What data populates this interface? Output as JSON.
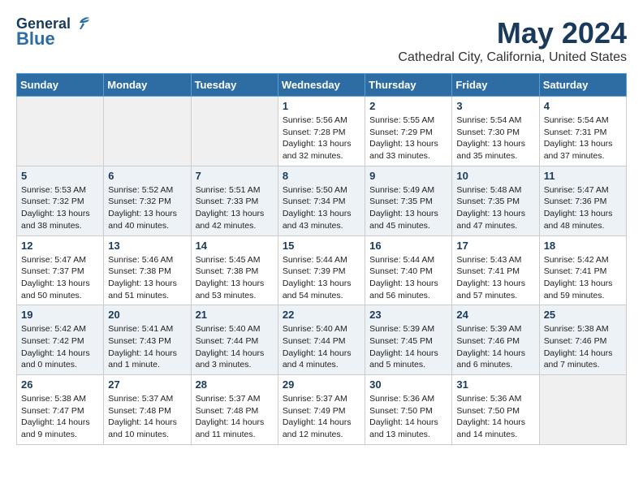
{
  "logo": {
    "line1": "General",
    "line2": "Blue"
  },
  "title": "May 2024",
  "location": "Cathedral City, California, United States",
  "days_of_week": [
    "Sunday",
    "Monday",
    "Tuesday",
    "Wednesday",
    "Thursday",
    "Friday",
    "Saturday"
  ],
  "weeks": [
    [
      {
        "day": "",
        "info": ""
      },
      {
        "day": "",
        "info": ""
      },
      {
        "day": "",
        "info": ""
      },
      {
        "day": "1",
        "info": "Sunrise: 5:56 AM\nSunset: 7:28 PM\nDaylight: 13 hours\nand 32 minutes."
      },
      {
        "day": "2",
        "info": "Sunrise: 5:55 AM\nSunset: 7:29 PM\nDaylight: 13 hours\nand 33 minutes."
      },
      {
        "day": "3",
        "info": "Sunrise: 5:54 AM\nSunset: 7:30 PM\nDaylight: 13 hours\nand 35 minutes."
      },
      {
        "day": "4",
        "info": "Sunrise: 5:54 AM\nSunset: 7:31 PM\nDaylight: 13 hours\nand 37 minutes."
      }
    ],
    [
      {
        "day": "5",
        "info": "Sunrise: 5:53 AM\nSunset: 7:32 PM\nDaylight: 13 hours\nand 38 minutes."
      },
      {
        "day": "6",
        "info": "Sunrise: 5:52 AM\nSunset: 7:32 PM\nDaylight: 13 hours\nand 40 minutes."
      },
      {
        "day": "7",
        "info": "Sunrise: 5:51 AM\nSunset: 7:33 PM\nDaylight: 13 hours\nand 42 minutes."
      },
      {
        "day": "8",
        "info": "Sunrise: 5:50 AM\nSunset: 7:34 PM\nDaylight: 13 hours\nand 43 minutes."
      },
      {
        "day": "9",
        "info": "Sunrise: 5:49 AM\nSunset: 7:35 PM\nDaylight: 13 hours\nand 45 minutes."
      },
      {
        "day": "10",
        "info": "Sunrise: 5:48 AM\nSunset: 7:35 PM\nDaylight: 13 hours\nand 47 minutes."
      },
      {
        "day": "11",
        "info": "Sunrise: 5:47 AM\nSunset: 7:36 PM\nDaylight: 13 hours\nand 48 minutes."
      }
    ],
    [
      {
        "day": "12",
        "info": "Sunrise: 5:47 AM\nSunset: 7:37 PM\nDaylight: 13 hours\nand 50 minutes."
      },
      {
        "day": "13",
        "info": "Sunrise: 5:46 AM\nSunset: 7:38 PM\nDaylight: 13 hours\nand 51 minutes."
      },
      {
        "day": "14",
        "info": "Sunrise: 5:45 AM\nSunset: 7:38 PM\nDaylight: 13 hours\nand 53 minutes."
      },
      {
        "day": "15",
        "info": "Sunrise: 5:44 AM\nSunset: 7:39 PM\nDaylight: 13 hours\nand 54 minutes."
      },
      {
        "day": "16",
        "info": "Sunrise: 5:44 AM\nSunset: 7:40 PM\nDaylight: 13 hours\nand 56 minutes."
      },
      {
        "day": "17",
        "info": "Sunrise: 5:43 AM\nSunset: 7:41 PM\nDaylight: 13 hours\nand 57 minutes."
      },
      {
        "day": "18",
        "info": "Sunrise: 5:42 AM\nSunset: 7:41 PM\nDaylight: 13 hours\nand 59 minutes."
      }
    ],
    [
      {
        "day": "19",
        "info": "Sunrise: 5:42 AM\nSunset: 7:42 PM\nDaylight: 14 hours\nand 0 minutes."
      },
      {
        "day": "20",
        "info": "Sunrise: 5:41 AM\nSunset: 7:43 PM\nDaylight: 14 hours\nand 1 minute."
      },
      {
        "day": "21",
        "info": "Sunrise: 5:40 AM\nSunset: 7:44 PM\nDaylight: 14 hours\nand 3 minutes."
      },
      {
        "day": "22",
        "info": "Sunrise: 5:40 AM\nSunset: 7:44 PM\nDaylight: 14 hours\nand 4 minutes."
      },
      {
        "day": "23",
        "info": "Sunrise: 5:39 AM\nSunset: 7:45 PM\nDaylight: 14 hours\nand 5 minutes."
      },
      {
        "day": "24",
        "info": "Sunrise: 5:39 AM\nSunset: 7:46 PM\nDaylight: 14 hours\nand 6 minutes."
      },
      {
        "day": "25",
        "info": "Sunrise: 5:38 AM\nSunset: 7:46 PM\nDaylight: 14 hours\nand 7 minutes."
      }
    ],
    [
      {
        "day": "26",
        "info": "Sunrise: 5:38 AM\nSunset: 7:47 PM\nDaylight: 14 hours\nand 9 minutes."
      },
      {
        "day": "27",
        "info": "Sunrise: 5:37 AM\nSunset: 7:48 PM\nDaylight: 14 hours\nand 10 minutes."
      },
      {
        "day": "28",
        "info": "Sunrise: 5:37 AM\nSunset: 7:48 PM\nDaylight: 14 hours\nand 11 minutes."
      },
      {
        "day": "29",
        "info": "Sunrise: 5:37 AM\nSunset: 7:49 PM\nDaylight: 14 hours\nand 12 minutes."
      },
      {
        "day": "30",
        "info": "Sunrise: 5:36 AM\nSunset: 7:50 PM\nDaylight: 14 hours\nand 13 minutes."
      },
      {
        "day": "31",
        "info": "Sunrise: 5:36 AM\nSunset: 7:50 PM\nDaylight: 14 hours\nand 14 minutes."
      },
      {
        "day": "",
        "info": ""
      }
    ]
  ]
}
